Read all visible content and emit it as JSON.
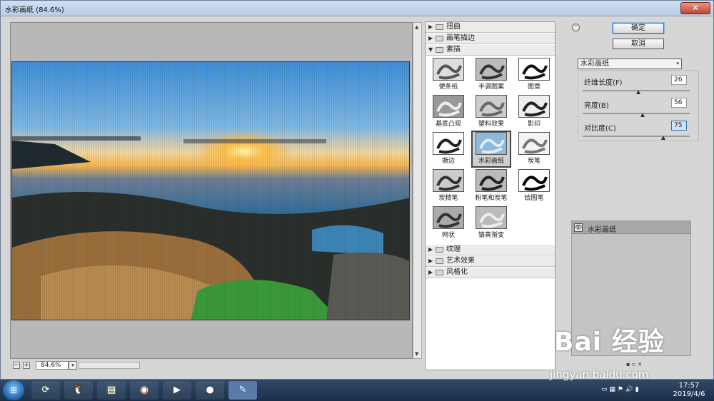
{
  "window": {
    "title": "水彩画纸 (84.6%)",
    "close_symbol": "✕"
  },
  "zoom": {
    "minus": "−",
    "plus": "+",
    "value": "84.6%",
    "dropdown_symbol": "▾"
  },
  "scrollbar": {
    "up": "▲",
    "down": "▼"
  },
  "filter_categories_top": [
    {
      "label": "扭曲",
      "expanded": false,
      "arrow": "▶"
    },
    {
      "label": "画笔描边",
      "expanded": false,
      "arrow": "▶"
    },
    {
      "label": "素描",
      "expanded": true,
      "arrow": "▼"
    }
  ],
  "sketch_filters": [
    {
      "label": "便条纸"
    },
    {
      "label": "半调图案"
    },
    {
      "label": "图章"
    },
    {
      "label": "基底凸现"
    },
    {
      "label": "塑料效果"
    },
    {
      "label": "影印"
    },
    {
      "label": "撕边"
    },
    {
      "label": "水彩画纸",
      "selected": true
    },
    {
      "label": "炭笔"
    },
    {
      "label": "炭精笔"
    },
    {
      "label": "粉笔和炭笔"
    },
    {
      "label": "绘图笔"
    },
    {
      "label": "网状"
    },
    {
      "label": "铬黄渐变"
    }
  ],
  "filter_categories_bottom": [
    {
      "label": "纹理",
      "arrow": "▶"
    },
    {
      "label": "艺术效果",
      "arrow": "▶"
    },
    {
      "label": "风格化",
      "arrow": "▶"
    }
  ],
  "actions": {
    "ok_label": "确定",
    "cancel_label": "取消",
    "collapse_symbol": "⌃"
  },
  "filter_select": {
    "value": "水彩画纸",
    "arrow": "▾"
  },
  "params": [
    {
      "label": "纤维长度(F)",
      "value": "26",
      "fraction": 0.52
    },
    {
      "label": "亮度(B)",
      "value": "56",
      "fraction": 0.56
    },
    {
      "label": "对比度(C)",
      "value": "75",
      "fraction": 0.75
    }
  ],
  "layers": {
    "name": "水彩画纸",
    "eye_symbol": "👁",
    "buttons": "▪ ▫ ✕"
  },
  "taskbar": {
    "start_symbol": "⊞",
    "apps": [
      {
        "name": "360-browser-icon",
        "symbol": "⟳"
      },
      {
        "name": "qq-icon",
        "symbol": "🐧"
      },
      {
        "name": "file-explorer-icon",
        "symbol": "▤"
      },
      {
        "name": "firefox-icon",
        "symbol": "◉"
      },
      {
        "name": "media-player-icon",
        "symbol": "▶"
      },
      {
        "name": "record-icon",
        "symbol": "●"
      },
      {
        "name": "feather-app-icon",
        "symbol": "✎"
      }
    ],
    "tray": "▭ ▦ ⚑ 🔊 ▮",
    "time": "17:57",
    "date": "2019/4/6"
  },
  "watermark": {
    "brand": "Bai 经验",
    "url": "jingyan.baidu.com"
  }
}
